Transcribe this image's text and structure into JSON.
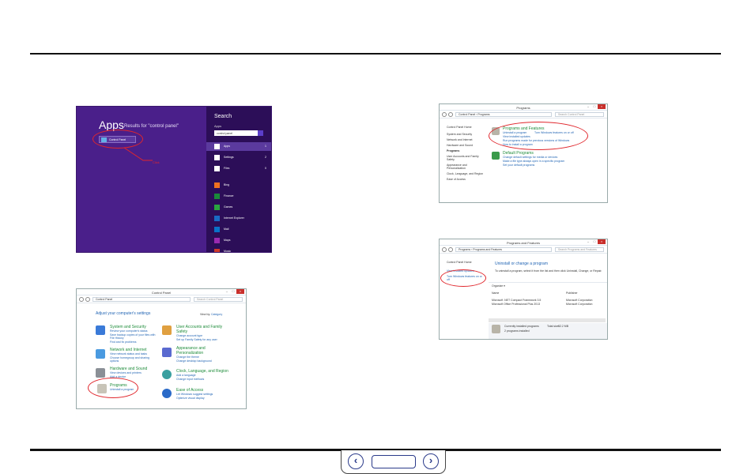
{
  "shot1": {
    "apps_title": "Apps",
    "results": "Results for \"control panel\"",
    "tile_label": "Control Panel",
    "click_note": "Click",
    "search_title": "Search",
    "scope": "Apps",
    "query": "control panel",
    "pane_rows": [
      {
        "label": "Apps",
        "count": "1"
      },
      {
        "label": "Settings",
        "count": "2"
      },
      {
        "label": "Files",
        "count": "0"
      },
      {
        "label": "Bing",
        "count": ""
      },
      {
        "label": "Finance",
        "count": ""
      },
      {
        "label": "Games",
        "count": ""
      },
      {
        "label": "Internet Explorer",
        "count": ""
      },
      {
        "label": "Mail",
        "count": ""
      },
      {
        "label": "Maps",
        "count": ""
      },
      {
        "label": "Music",
        "count": ""
      }
    ]
  },
  "shot2": {
    "title": "Control Panel",
    "path": "Control Panel",
    "search": "Search Control Panel",
    "heading": "Adjust your computer's settings",
    "viewby": "View by:",
    "category": "Category",
    "left": [
      {
        "title": "System and Security",
        "sub1": "Review your computer's status",
        "sub2": "Save backup copies of your files with File History",
        "sub3": "Find and fix problems"
      },
      {
        "title": "Network and Internet",
        "sub1": "View network status and tasks",
        "sub2": "Choose homegroup and sharing options",
        "sub3": ""
      },
      {
        "title": "Hardware and Sound",
        "sub1": "View devices and printers",
        "sub2": "Add a device",
        "sub3": ""
      },
      {
        "title": "Programs",
        "sub1": "Uninstall a program",
        "sub2": "",
        "sub3": ""
      }
    ],
    "right": [
      {
        "title": "User Accounts and Family Safety",
        "sub1": "Change account type",
        "sub2": "Set up Family Safety for any user"
      },
      {
        "title": "Appearance and Personalization",
        "sub1": "Change the theme",
        "sub2": "Change desktop background"
      },
      {
        "title": "Clock, Language, and Region",
        "sub1": "Add a language",
        "sub2": "Change input methods"
      },
      {
        "title": "Ease of Access",
        "sub1": "Let Windows suggest settings",
        "sub2": "Optimize visual display"
      }
    ]
  },
  "shot3": {
    "title": "Programs",
    "path": "Control Panel › Programs",
    "search": "Search Control Panel",
    "side": [
      "Control Panel Home",
      "System and Security",
      "Network and Internet",
      "Hardware and Sound",
      "Programs",
      "User Accounts and Family Safety",
      "Appearance and Personalization",
      "Clock, Language, and Region",
      "Ease of Access"
    ],
    "pf_title": "Programs and Features",
    "pf_l1": "Uninstall a program",
    "pf_l1b": "Turn Windows features on or off",
    "pf_l2": "View installed updates",
    "pf_l3": "Run programs made for previous versions of Windows",
    "pf_l4": "How to install a program",
    "dp_title": "Default Programs",
    "dp_l1": "Change default settings for media or devices",
    "dp_l2": "Make a file type always open in a specific program",
    "dp_l3": "Set your default programs"
  },
  "shot4": {
    "title": "Programs and Features",
    "path": "Programs › Programs and Features",
    "search": "Search Programs and Features",
    "side1": "Control Panel Home",
    "side2": "View installed updates",
    "side3": "Turn Windows features on or off",
    "heading": "Uninstall or change a program",
    "desc": "To uninstall a program, select it from the list and then click Uninstall, Change, or Repair.",
    "organize": "Organize ▾",
    "col_name": "Name",
    "col_pub": "Publisher",
    "rows": [
      {
        "name": "Microsoft .NET Compact Framework 3.5",
        "pub": "Microsoft Corporation"
      },
      {
        "name": "Microsoft Office Professional Plus 2013",
        "pub": "Microsoft Corporation"
      }
    ],
    "status1": "Currently installed programs",
    "status_total": "Total size:",
    "status_size": "52.2 MB",
    "status2": "2 programs installed"
  },
  "colors": {
    "purple": "#4a1f8a",
    "ring": "#e0262c",
    "green": "#1e8c3a",
    "blue": "#1f63b3"
  }
}
